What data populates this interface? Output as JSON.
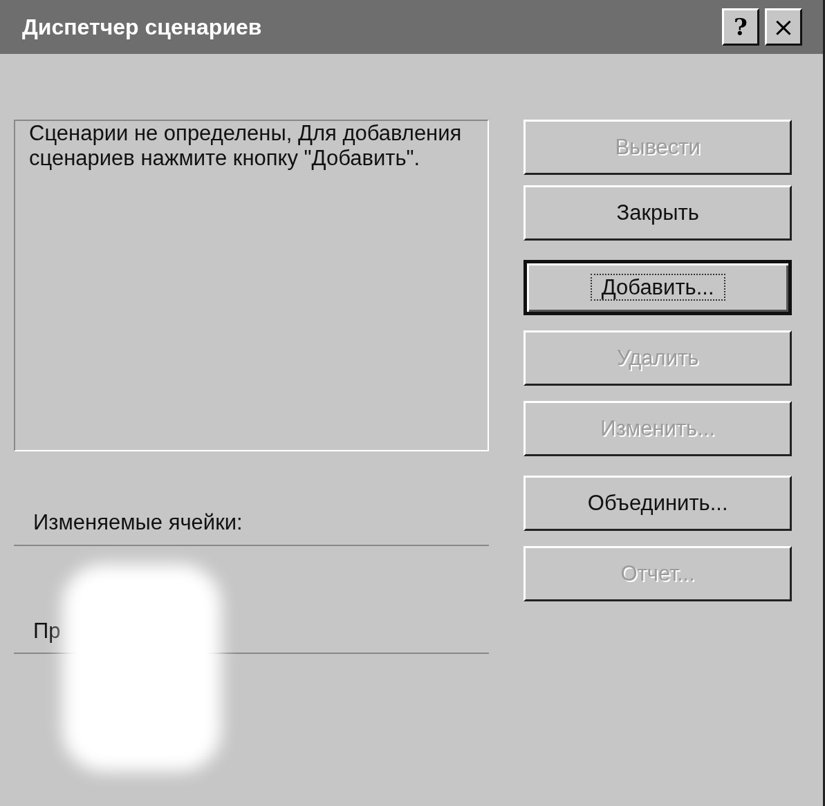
{
  "window": {
    "title": "Диспетчер сценариев",
    "title_buttons": [
      {
        "kind": "help",
        "label": "?"
      },
      {
        "kind": "close",
        "label": "×"
      }
    ]
  },
  "scenario_list": {
    "message": "Сценарии не определены, Для добавления сценариев нажмите кнопку \"Добавить\"."
  },
  "changing_cells": {
    "label": "Изменяемые ячейки:"
  },
  "comment": {
    "label": "Пр"
  },
  "buttons": [
    {
      "label": "Вывести",
      "disabled": true,
      "focused": false
    },
    {
      "label": "Закрыть",
      "disabled": false,
      "focused": false
    },
    {
      "label": "Добавить...",
      "disabled": false,
      "focused": true
    },
    {
      "label": "Удалить",
      "disabled": true,
      "focused": false
    },
    {
      "label": "Изменить...",
      "disabled": true,
      "focused": false
    },
    {
      "label": "Объединить...",
      "disabled": false,
      "focused": false
    },
    {
      "label": "Отчет...",
      "disabled": true,
      "focused": false
    }
  ]
}
